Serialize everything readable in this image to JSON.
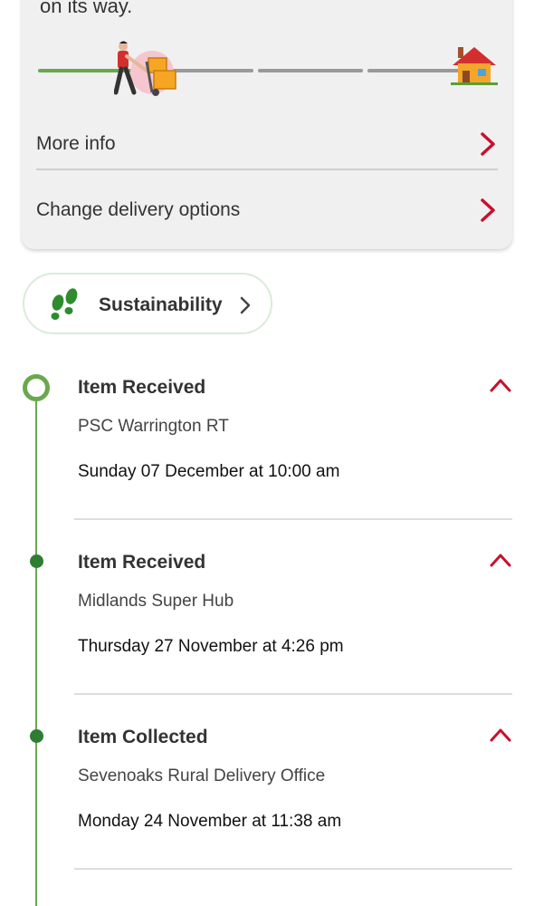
{
  "status": {
    "cut_text": "on its way.",
    "progress_fraction": 0.25,
    "courier_icon": "courier-with-boxes-icon",
    "home_icon": "house-icon"
  },
  "card_rows": [
    {
      "label": "More info",
      "icon": "chevron-right-icon"
    },
    {
      "label": "Change delivery options",
      "icon": "chevron-right-icon"
    }
  ],
  "sustainability": {
    "label": "Sustainability",
    "icon": "footprints-icon"
  },
  "events": [
    {
      "title": "Item Received",
      "location": "PSC Warrington RT",
      "datetime": "Sunday 07 December at 10:00 am",
      "marker": "ring"
    },
    {
      "title": "Item Received",
      "location": "Midlands Super Hub",
      "datetime": "Thursday 27 November at 4:26 pm",
      "marker": "dot"
    },
    {
      "title": "Item Collected",
      "location": "Sevenoaks Rural Delivery Office",
      "datetime": "Monday 24 November at 11:38 am",
      "marker": "dot"
    }
  ],
  "colors": {
    "accent_red": "#c8102e",
    "progress_green": "#6aa84f",
    "dot_green": "#2e7d32"
  }
}
